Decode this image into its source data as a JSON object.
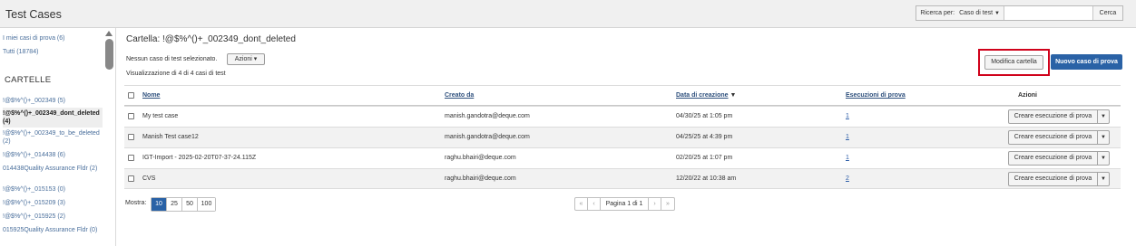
{
  "app": {
    "title": "Test Cases"
  },
  "search": {
    "label": "Ricerca per:",
    "scope_value": "Caso di test",
    "input_value": "",
    "button_label": "Cerca"
  },
  "sidebar": {
    "my_cases": "I miei casi di prova (6)",
    "all_cases": "Tutti (18784)",
    "folders_heading": "CARTELLE",
    "folders": [
      {
        "label": "!@$%^()+_002349 (5)"
      },
      {
        "label": "!@$%^()+_002349_dont_deleted (4)"
      },
      {
        "label": "!@$%^()+_002349_to_be_deleted (2)"
      },
      {
        "label": "!@$%^()+_014438 (6)"
      },
      {
        "label": "014438Quality Assurance Fldr (2)"
      },
      {
        "label": "!@$%^()+_015153 (0)"
      },
      {
        "label": "!@$%^()+_015209 (3)"
      },
      {
        "label": "!@$%^()+_015925 (2)"
      },
      {
        "label": "015925Quality Assurance Fldr (0)"
      }
    ]
  },
  "main": {
    "folder_title": "Cartella: !@$%^()+_002349_dont_deleted",
    "selection_info": "Nessun caso di test selezionato.",
    "actions_label": "Azioni",
    "view_info": "Visualizzazione di 4 di 4 casi di test",
    "edit_folder_label": "Modifica cartella",
    "new_case_label": "Nuovo caso di prova"
  },
  "table": {
    "headers": {
      "name": "Nome",
      "created_by": "Creato da",
      "created_date": "Data di creazione",
      "sort_indicator": "▼",
      "runs": "Esecuzioni di prova",
      "actions": "Azioni"
    },
    "rows": [
      {
        "name": "My test case",
        "created_by": "manish.gandotra@deque.com",
        "date": "04/30/25 at 1:05 pm",
        "runs": "1",
        "action": "Creare esecuzione di prova"
      },
      {
        "name": "Manish Test case12",
        "created_by": "manish.gandotra@deque.com",
        "date": "04/25/25 at 4:39 pm",
        "runs": "1",
        "action": "Creare esecuzione di prova"
      },
      {
        "name": "IGT-Import - 2025-02-20T07-37-24.115Z",
        "created_by": "raghu.bhairi@deque.com",
        "date": "02/20/25 at 1:07 pm",
        "runs": "1",
        "action": "Creare esecuzione di prova"
      },
      {
        "name": "CVS",
        "created_by": "raghu.bhairi@deque.com",
        "date": "12/20/22 at 10:38 am",
        "runs": "2",
        "action": "Creare esecuzione di prova"
      }
    ]
  },
  "pagination": {
    "show_label": "Mostra:",
    "page_sizes": [
      "10",
      "25",
      "50",
      "100"
    ],
    "active_page_size": "10",
    "page_info": "Pagina 1 di 1",
    "first": "«",
    "prev": "‹",
    "next": "›",
    "last": "»"
  },
  "colors": {
    "accent": "#2a62a6",
    "highlight_box": "#d0021b",
    "link": "#4a6f9c"
  }
}
